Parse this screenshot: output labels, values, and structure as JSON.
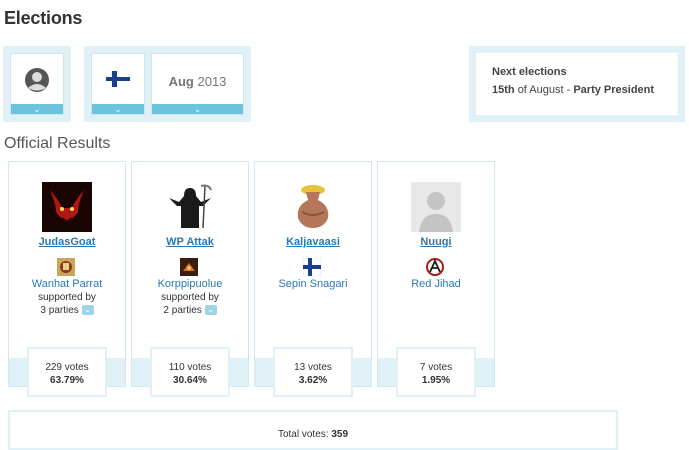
{
  "page": {
    "title": "Elections"
  },
  "filters": {
    "month": "Aug",
    "year": "2013",
    "dropdown_icon": "chevron-down-icon"
  },
  "next_elections": {
    "title": "Next elections",
    "day": "15th",
    "of_text": "of August -",
    "type": "Party President"
  },
  "results": {
    "title": "Official Results",
    "candidates": [
      {
        "name": "JudasGoat",
        "party": "Wanhat Parrat",
        "supported_by": "supported by",
        "parties_count": "3 parties",
        "votes": "229 votes",
        "percent": "63.79%"
      },
      {
        "name": "WP Attak",
        "party": "Korppipuolue",
        "supported_by": "supported by",
        "parties_count": "2 parties",
        "votes": "110 votes",
        "percent": "30.64%"
      },
      {
        "name": "Kaljavaasi",
        "party": "Sepin Snagari",
        "supported_by": "",
        "parties_count": "",
        "votes": "13 votes",
        "percent": "3.62%"
      },
      {
        "name": "Nuugi",
        "party": "Red Jihad",
        "supported_by": "",
        "parties_count": "",
        "votes": "7 votes",
        "percent": "1.95%"
      }
    ],
    "total_label": "Total votes:",
    "total_votes": "359"
  },
  "colors": {
    "accent": "#6cc3de",
    "panel": "#dff0f7",
    "link": "#2a78b3"
  }
}
